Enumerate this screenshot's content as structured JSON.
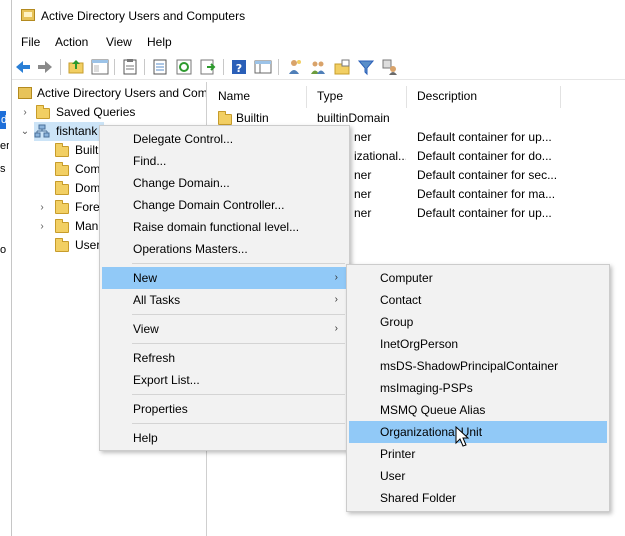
{
  "window": {
    "title": "Active Directory Users and Computers"
  },
  "desktop_fragments": {
    "blue_label": "d",
    "texts": [
      "er",
      "s",
      "o"
    ]
  },
  "menubar": [
    "File",
    "Action",
    "View",
    "Help"
  ],
  "toolbar_icons": [
    "back-arrow-icon",
    "forward-arrow-icon",
    "up-folder-icon",
    "show-hide-tree-icon",
    "properties-icon",
    "export-list-icon",
    "refresh-icon",
    "export-icon",
    "help-icon",
    "view-pane-icon",
    "new-user-icon",
    "new-group-icon",
    "new-ou-icon",
    "filter-icon",
    "delegate-icon"
  ],
  "tree": {
    "root": "Active Directory Users and Com",
    "items": [
      {
        "label": "Saved Queries"
      },
      {
        "label": "fishtank"
      },
      {
        "label": "Built"
      },
      {
        "label": "Com"
      },
      {
        "label": "Dom"
      },
      {
        "label": "Fore"
      },
      {
        "label": "Man"
      },
      {
        "label": "User"
      }
    ]
  },
  "list": {
    "columns": [
      "Name",
      "Type",
      "Description"
    ],
    "rows": [
      {
        "name": "Builtin",
        "type": "builtinDomain",
        "description": ""
      },
      {
        "name": "",
        "type": "ner",
        "description": "Default container for up..."
      },
      {
        "name": "",
        "type": "izational...",
        "description": "Default container for do..."
      },
      {
        "name": "",
        "type": "ner",
        "description": "Default container for sec..."
      },
      {
        "name": "",
        "type": "ner",
        "description": "Default container for ma..."
      },
      {
        "name": "",
        "type": "ner",
        "description": "Default container for up..."
      }
    ]
  },
  "context_menu": {
    "group1": [
      "Delegate Control...",
      "Find...",
      "Change Domain...",
      "Change Domain Controller...",
      "Raise domain functional level...",
      "Operations Masters..."
    ],
    "new_label": "New",
    "all_tasks_label": "All Tasks",
    "view_label": "View",
    "refresh_label": "Refresh",
    "export_label": "Export List...",
    "properties_label": "Properties",
    "help_label": "Help",
    "submenu_arrow": "›"
  },
  "new_submenu": {
    "items": [
      "Computer",
      "Contact",
      "Group",
      "InetOrgPerson",
      "msDS-ShadowPrincipalContainer",
      "msImaging-PSPs",
      "MSMQ Queue Alias",
      "Organizational Unit",
      "Printer",
      "User",
      "Shared Folder"
    ],
    "highlighted": "Organizational Unit"
  },
  "colors": {
    "highlight": "#91c9f7",
    "menu_bg": "#f2f2f2",
    "selection": "#cce4f7"
  }
}
